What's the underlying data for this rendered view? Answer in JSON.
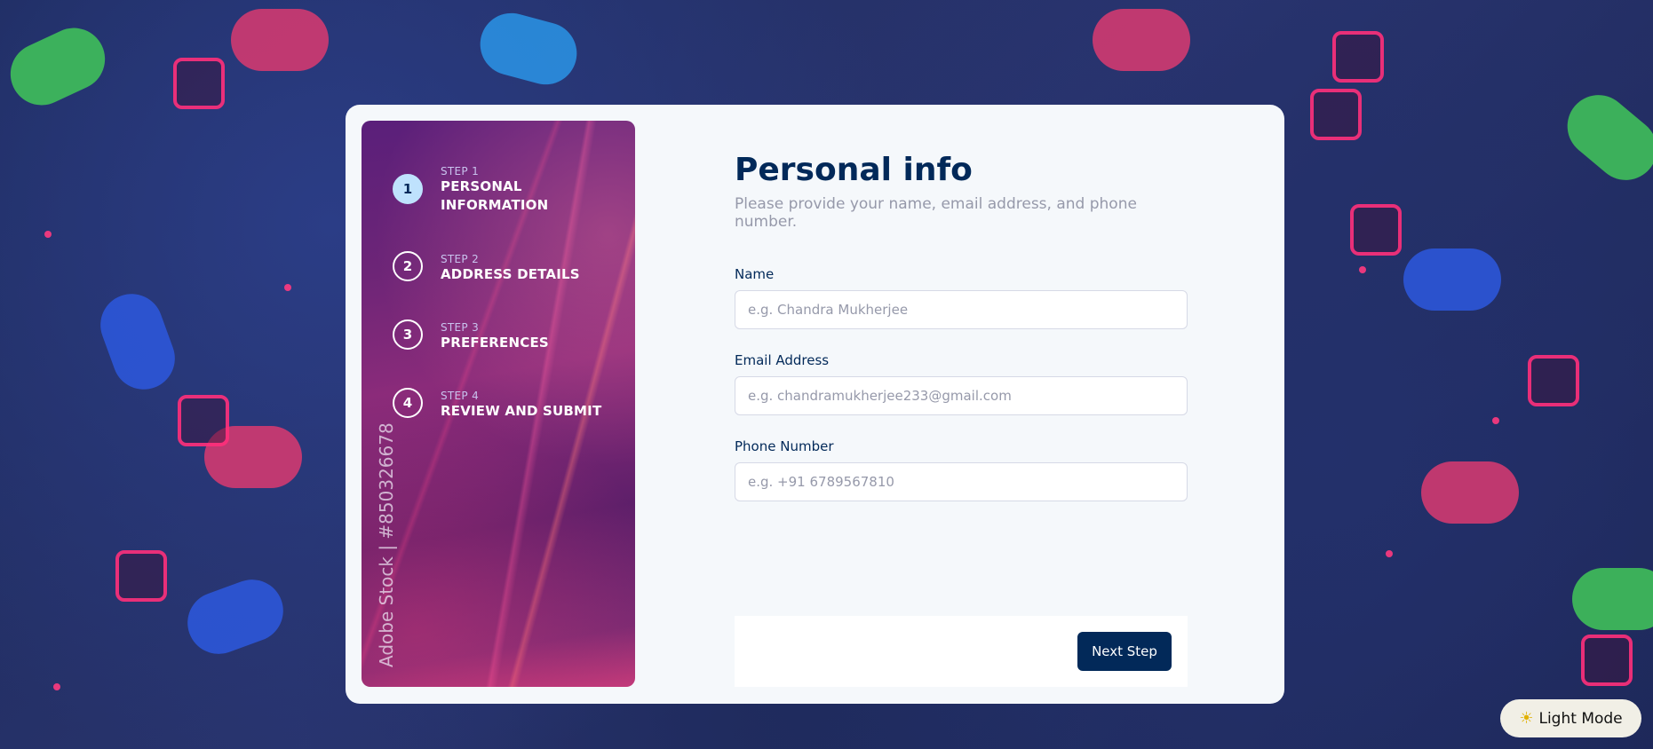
{
  "steps": [
    {
      "number": "1",
      "label": "STEP 1",
      "title_line1": "PERSONAL",
      "title_line2": "INFORMATION"
    },
    {
      "number": "2",
      "label": "STEP 2",
      "title": "ADDRESS DETAILS"
    },
    {
      "number": "3",
      "label": "STEP 3",
      "title": "PREFERENCES"
    },
    {
      "number": "4",
      "label": "STEP 4",
      "title": "REVIEW AND SUBMIT"
    }
  ],
  "sidebar": {
    "watermark": "Adobe Stock | #850326678"
  },
  "form": {
    "title": "Personal info",
    "subtitle": "Please provide your name, email address, and phone number.",
    "name": {
      "label": "Name",
      "placeholder": "e.g. Chandra Mukherjee",
      "value": ""
    },
    "email": {
      "label": "Email Address",
      "placeholder": "e.g. chandramukherjee233@gmail.com",
      "value": ""
    },
    "phone": {
      "label": "Phone Number",
      "placeholder": "e.g. +91 6789567810",
      "value": ""
    }
  },
  "actions": {
    "next_label": "Next Step"
  },
  "theme_toggle": {
    "icon": "sun-icon",
    "label": "Light Mode"
  },
  "colors": {
    "primary": "#022959",
    "active_step": "#bfe2fd",
    "muted": "#9699aa",
    "card_bg": "#f5f8fb"
  }
}
